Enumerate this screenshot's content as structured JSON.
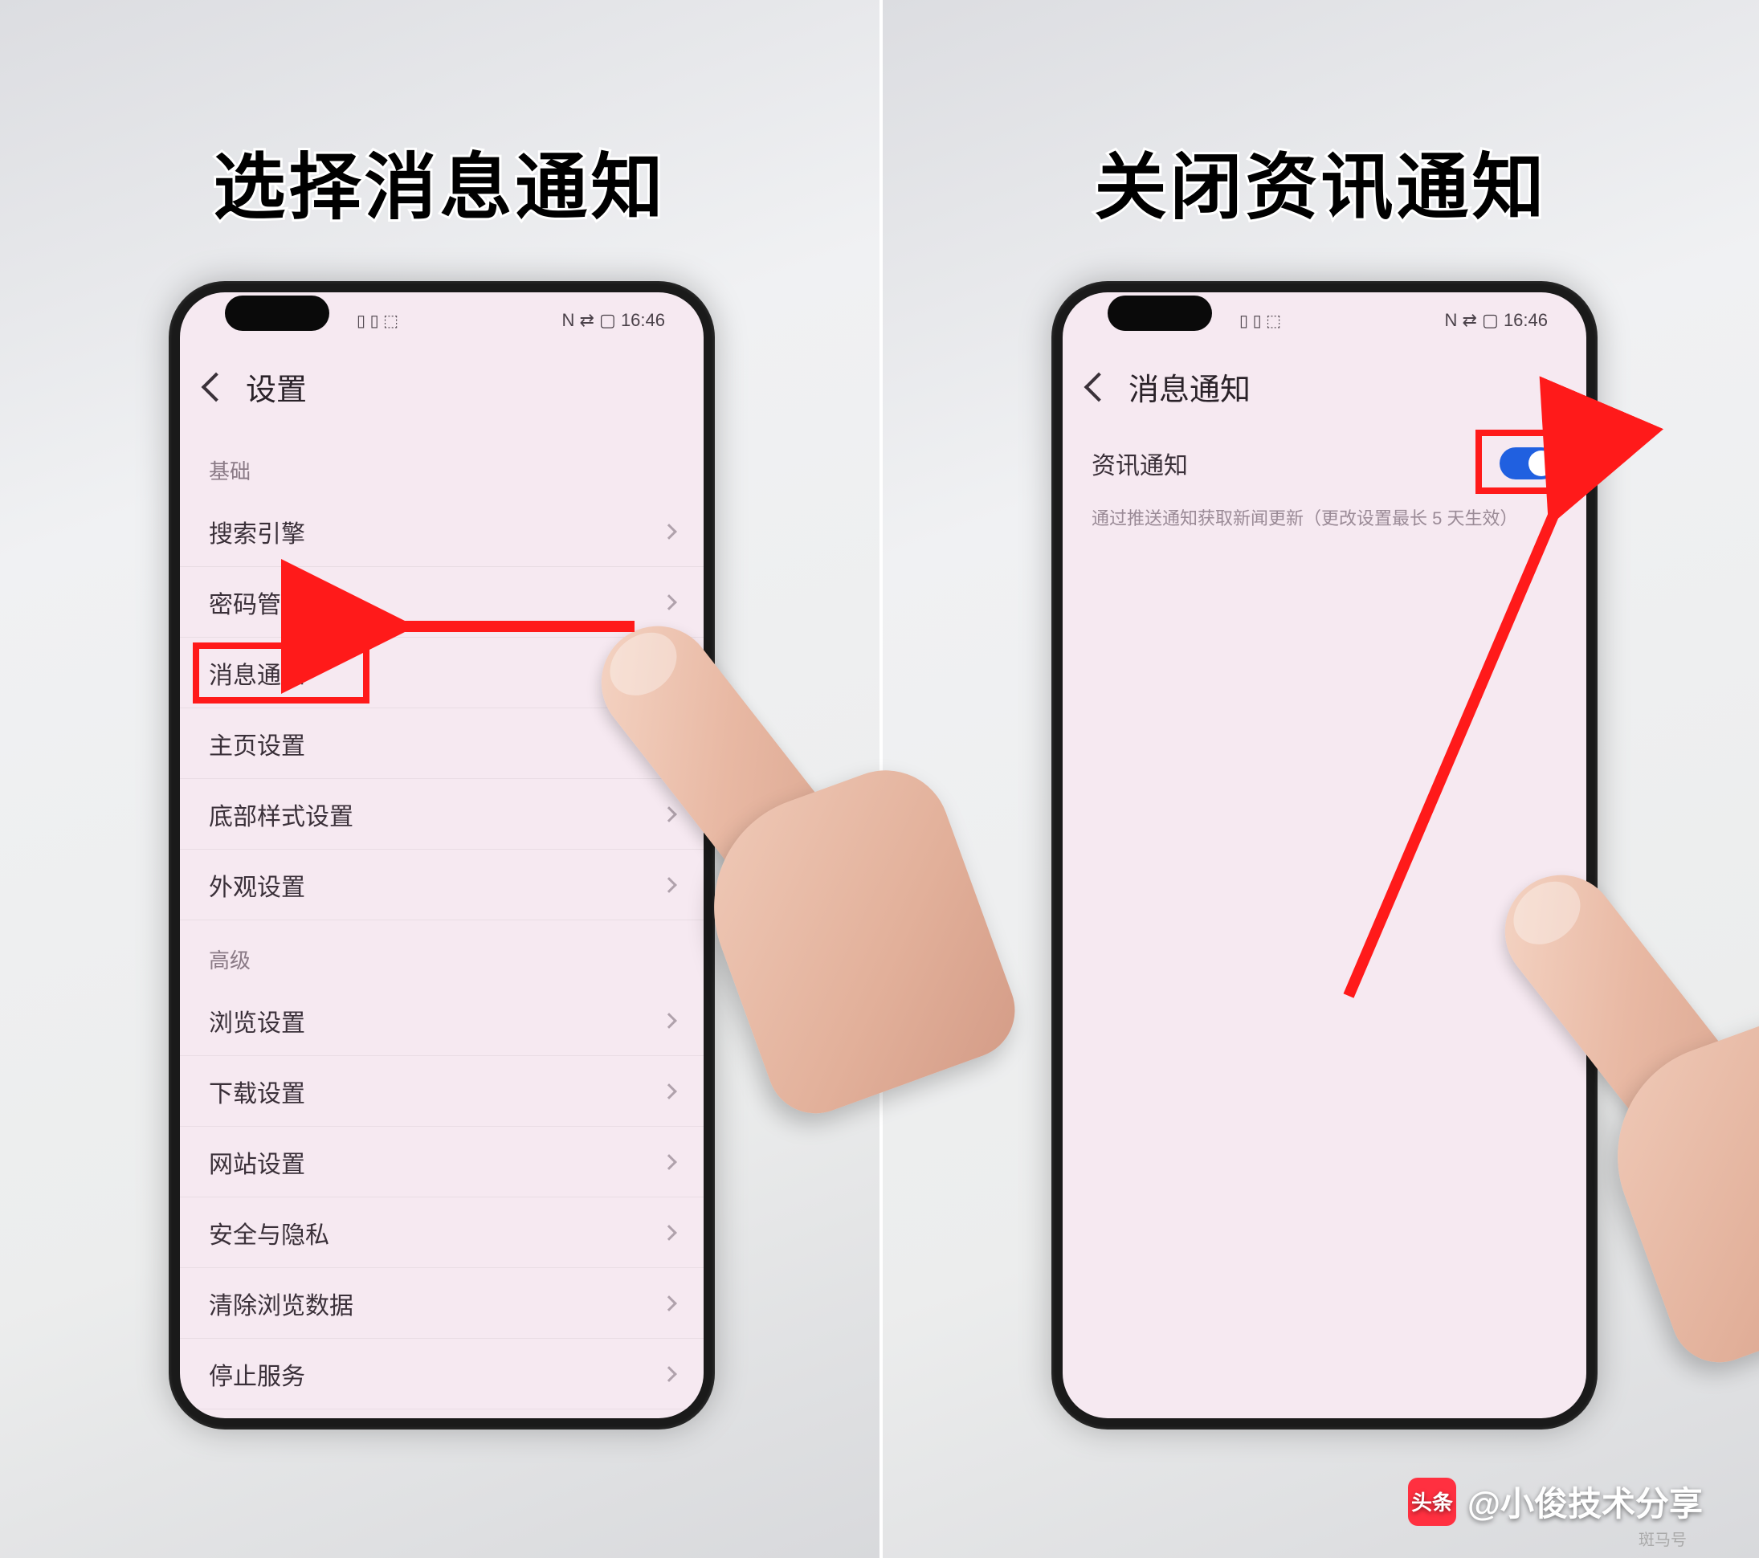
{
  "left": {
    "caption": "选择消息通知",
    "status": {
      "left": "▯ ▯ ⬚",
      "right": "N ⇄ ▢ 16:46"
    },
    "header_title": "设置",
    "section_basic": "基础",
    "items_basic": [
      "搜索引擎",
      "密码管理",
      "消息通知",
      "主页设置",
      "底部样式设置",
      "外观设置"
    ],
    "section_advanced": "高级",
    "items_advanced": [
      "浏览设置",
      "下载设置",
      "网站设置",
      "安全与隐私",
      "清除浏览数据",
      "停止服务"
    ],
    "highlight_index": 2
  },
  "right": {
    "caption": "关闭资讯通知",
    "status": {
      "left": "▯ ▯ ⬚",
      "right": "N ⇄ ▢ 16:46"
    },
    "header_title": "消息通知",
    "toggle_label": "资讯通知",
    "toggle_on": true,
    "hint": "通过推送通知获取新闻更新（更改设置最长 5 天生效）"
  },
  "watermark": {
    "logo": "头条",
    "text": "@小俊技术分享",
    "small": "斑马号"
  }
}
